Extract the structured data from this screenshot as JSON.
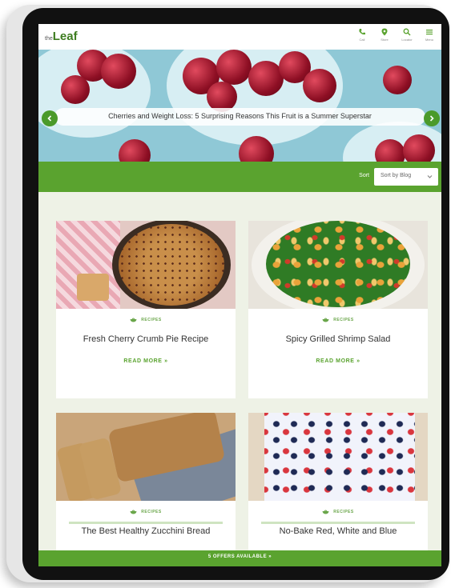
{
  "header": {
    "logo_prefix": "the",
    "logo_text": "Leaf",
    "nav": [
      {
        "label": "Call",
        "icon": "phone-icon"
      },
      {
        "label": "Store",
        "icon": "location-icon"
      },
      {
        "label": "Locator",
        "icon": "search-icon"
      },
      {
        "label": "Menu",
        "icon": "menu-icon"
      }
    ]
  },
  "hero": {
    "caption": "Cherries and Weight Loss: 5 Surprising Reasons This Fruit is a Summer Superstar"
  },
  "filter": {
    "label": "Sort",
    "selected": "Sort by Blog"
  },
  "cards": [
    {
      "category": "RECIPES",
      "title": "Fresh Cherry Crumb Pie Recipe",
      "read_more": "READ MORE »"
    },
    {
      "category": "RECIPES",
      "title": "Spicy Grilled Shrimp Salad",
      "read_more": "READ MORE »"
    },
    {
      "category": "RECIPES",
      "title": "The Best Healthy Zucchini Bread",
      "read_more": ""
    },
    {
      "category": "RECIPES",
      "title": "No-Bake Red, White and Blue",
      "read_more": ""
    }
  ],
  "bottom_bar": {
    "label": "5 OFFERS AVAILABLE  »"
  },
  "colors": {
    "brand_green": "#5aa32f",
    "dark_green": "#3d7c1f",
    "page_bg": "#eef2e6"
  }
}
